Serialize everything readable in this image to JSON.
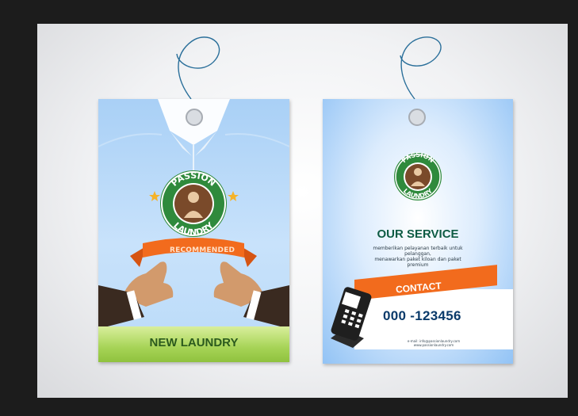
{
  "brand": {
    "seal_top": "PASSION",
    "seal_bottom": "LAUNDRY"
  },
  "left_tag": {
    "banner": "RECOMMENDED",
    "footer": "NEW LAUNDRY"
  },
  "right_tag": {
    "title": "OUR SERVICE",
    "description_lines": [
      "memberikan pelayanan terbaik untuk",
      "pelanggan,",
      "menawarkan paket kiloan dan paket",
      "premium"
    ],
    "contact_label": "CONTACT",
    "phone": "000 -123456",
    "small_print_lines": [
      "e-mail: info@passionlaundry.com",
      "www.passionlaundry.com"
    ]
  },
  "colors": {
    "frame": "#1c1c1c",
    "orange": "#f26b1d",
    "seal_green": "#2f8a3c",
    "title_green": "#0d5b43",
    "phone_blue": "#0a3a6a"
  }
}
